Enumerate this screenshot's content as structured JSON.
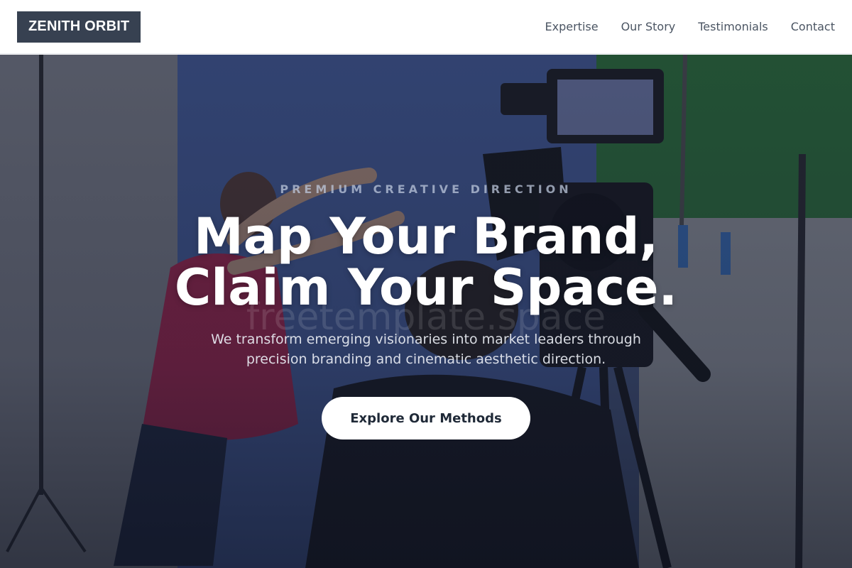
{
  "header": {
    "logo": "ZENITH ORBIT",
    "nav": [
      {
        "label": "Expertise"
      },
      {
        "label": "Our Story"
      },
      {
        "label": "Testimonials"
      },
      {
        "label": "Contact"
      }
    ]
  },
  "hero": {
    "eyebrow": "PREMIUM CREATIVE DIRECTION",
    "headline_line1": "Map Your Brand,",
    "headline_line2": "Claim Your Space.",
    "watermark": "freetemplate.space",
    "subtext": "We transform emerging visionaries into market leaders through precision branding and cinematic aesthetic direction.",
    "cta_label": "Explore Our Methods",
    "background_image": "film-studio-camera-crew-photo"
  },
  "colors": {
    "logo_bg": "#374151",
    "nav_text": "#4b5563",
    "cta_bg": "#ffffff",
    "cta_text": "#1f2937"
  }
}
